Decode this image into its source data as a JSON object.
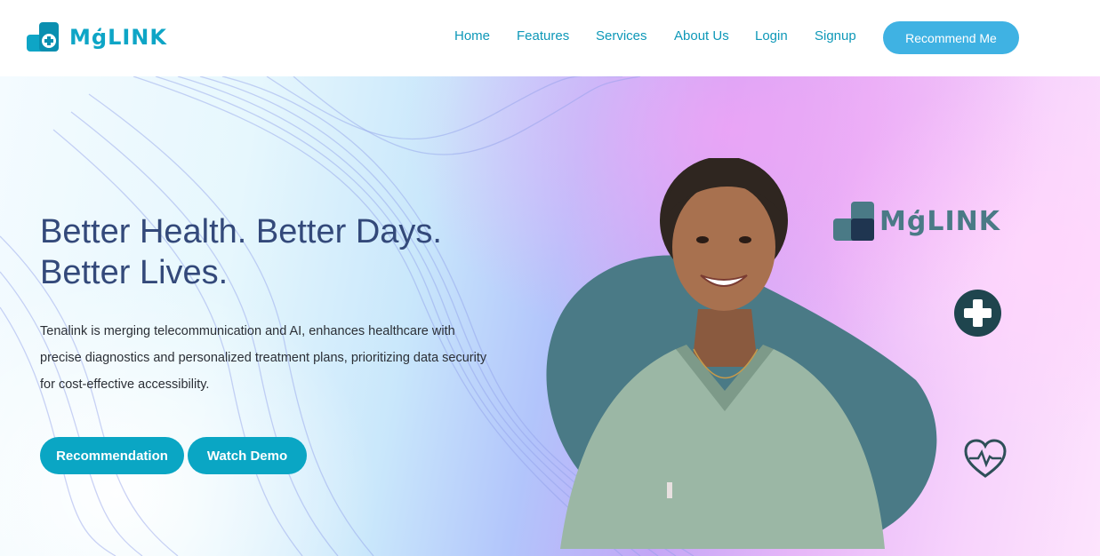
{
  "brand": {
    "logo_text": "MģLINK",
    "logo_icon": "medical-cross-logo"
  },
  "nav": {
    "items": [
      {
        "label": "Home"
      },
      {
        "label": "Features"
      },
      {
        "label": "Services"
      },
      {
        "label": "About Us"
      },
      {
        "label": "Login"
      },
      {
        "label": "Signup"
      }
    ],
    "cta_label": "Recommend Me"
  },
  "hero": {
    "headline_line1": "Better Health. Better Days.",
    "headline_line2": "Better Lives.",
    "description": "Tenalink is merging telecommunication and AI, enhances healthcare with precise diagnostics and personalized treatment plans, prioritizing data security for cost-effective accessibility.",
    "primary_button": "Recommendation",
    "secondary_button": "Watch Demo",
    "side_logo_text": "MģLINK",
    "badge_icon": "plus-cross-icon",
    "heart_icon": "heart-pulse-icon",
    "portrait": "smiling-nurse-in-green-scrubs"
  },
  "colors": {
    "brand": "#0ea5c6",
    "nav_text": "#0e98b8",
    "cta": "#3fb2e3",
    "hero_button": "#0aa6c4",
    "headline": "#33497a",
    "blob": "#4a7a86",
    "badge": "#1f454e"
  }
}
